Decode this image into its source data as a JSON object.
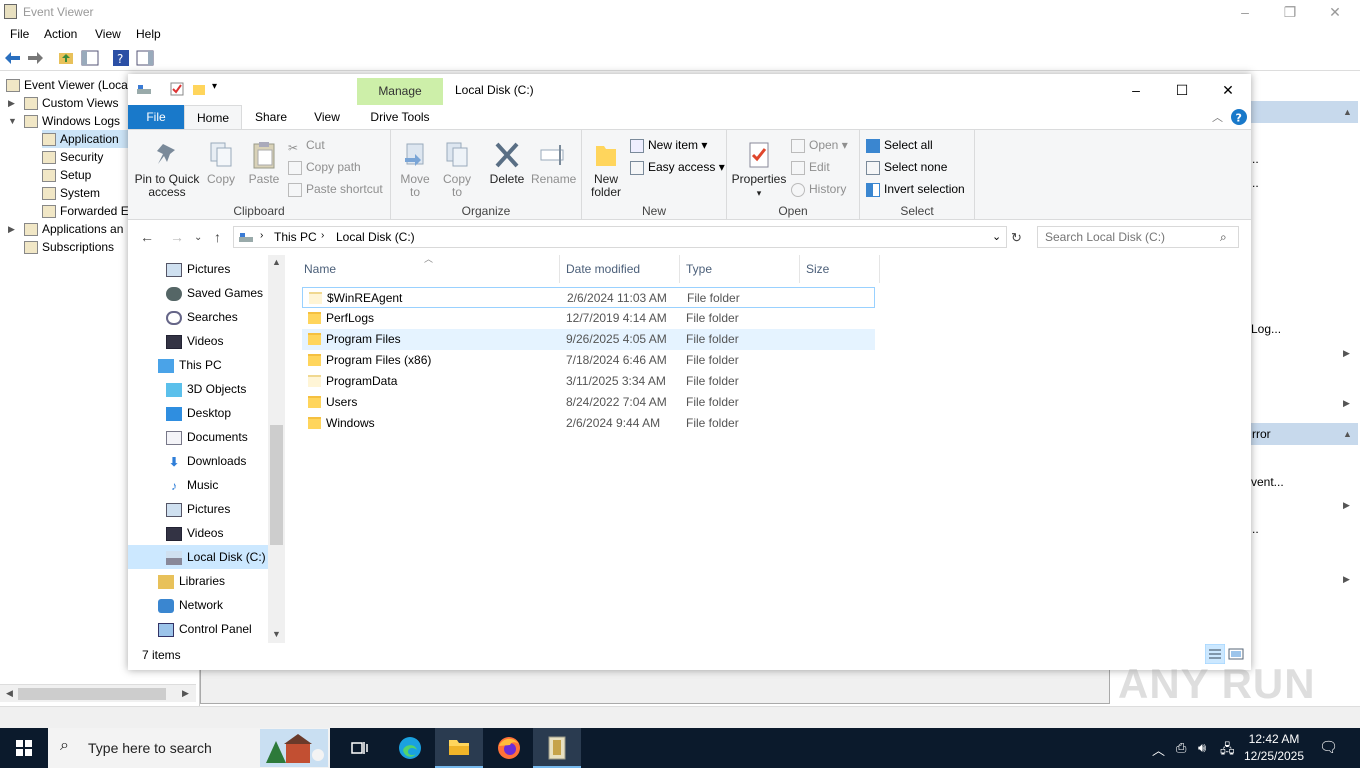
{
  "event_viewer": {
    "title": "Event Viewer",
    "menu": [
      "File",
      "Action",
      "View",
      "Help"
    ],
    "tree": {
      "root": "Event Viewer (Local",
      "custom_views": "Custom Views",
      "windows_logs": "Windows Logs",
      "application": "Application",
      "security": "Security",
      "setup": "Setup",
      "system": "System",
      "forwarded": "Forwarded E",
      "apps_services": "Applications an",
      "subscriptions": "Subscriptions"
    },
    "actions": {
      "log": "Log...",
      "error_header": "rror",
      "event": "vent...",
      "ellipsis1": "..",
      "ellipsis2": "..",
      "ellipsis3": ".."
    }
  },
  "explorer": {
    "title": "Local Disk (C:)",
    "manage_label": "Manage",
    "tabs": {
      "file": "File",
      "home": "Home",
      "share": "Share",
      "view": "View",
      "drive_tools": "Drive Tools"
    },
    "ribbon": {
      "clipboard": {
        "label": "Clipboard",
        "pin": "Pin to Quick access",
        "copy": "Copy",
        "paste": "Paste",
        "cut": "Cut",
        "copy_path": "Copy path",
        "paste_shortcut": "Paste shortcut"
      },
      "organize": {
        "label": "Organize",
        "move_to": "Move to",
        "copy_to": "Copy to",
        "delete": "Delete",
        "rename": "Rename"
      },
      "new": {
        "label": "New",
        "new_folder": "New folder",
        "new_item": "New item",
        "easy_access": "Easy access"
      },
      "open": {
        "label": "Open",
        "properties": "Properties",
        "open": "Open",
        "edit": "Edit",
        "history": "History"
      },
      "select": {
        "label": "Select",
        "select_all": "Select all",
        "select_none": "Select none",
        "invert": "Invert selection"
      }
    },
    "address": {
      "this_pc": "This PC",
      "current": "Local Disk (C:)"
    },
    "search": {
      "placeholder": "Search Local Disk (C:)"
    },
    "nav": [
      {
        "label": "Pictures",
        "icon": "pictures-icon"
      },
      {
        "label": "Saved Games",
        "icon": "saved-games-icon"
      },
      {
        "label": "Searches",
        "icon": "searches-icon"
      },
      {
        "label": "Videos",
        "icon": "videos-icon"
      },
      {
        "label": "This PC",
        "icon": "this-pc-icon"
      },
      {
        "label": "3D Objects",
        "icon": "3d-objects-icon"
      },
      {
        "label": "Desktop",
        "icon": "desktop-icon"
      },
      {
        "label": "Documents",
        "icon": "documents-icon"
      },
      {
        "label": "Downloads",
        "icon": "downloads-icon"
      },
      {
        "label": "Music",
        "icon": "music-icon"
      },
      {
        "label": "Pictures",
        "icon": "pictures-icon"
      },
      {
        "label": "Videos",
        "icon": "videos-icon"
      },
      {
        "label": "Local Disk (C:)",
        "icon": "drive-icon"
      },
      {
        "label": "Libraries",
        "icon": "libraries-icon"
      },
      {
        "label": "Network",
        "icon": "network-icon"
      },
      {
        "label": "Control Panel",
        "icon": "control-panel-icon"
      }
    ],
    "columns": {
      "name": "Name",
      "date": "Date modified",
      "type": "Type",
      "size": "Size"
    },
    "files": [
      {
        "name": "$WinREAgent",
        "date": "2/6/2024 11:03 AM",
        "type": "File folder"
      },
      {
        "name": "PerfLogs",
        "date": "12/7/2019 4:14 AM",
        "type": "File folder"
      },
      {
        "name": "Program Files",
        "date": "9/26/2025 4:05 AM",
        "type": "File folder"
      },
      {
        "name": "Program Files (x86)",
        "date": "7/18/2024 6:46 AM",
        "type": "File folder"
      },
      {
        "name": "ProgramData",
        "date": "3/11/2025 3:34 AM",
        "type": "File folder"
      },
      {
        "name": "Users",
        "date": "8/24/2022 7:04 AM",
        "type": "File folder"
      },
      {
        "name": "Windows",
        "date": "2/6/2024 9:44 AM",
        "type": "File folder"
      }
    ],
    "status": "7 items"
  },
  "taskbar": {
    "search_placeholder": "Type here to search",
    "time": "12:42 AM",
    "date": "12/25/2025"
  },
  "watermark": "ANY RUN"
}
